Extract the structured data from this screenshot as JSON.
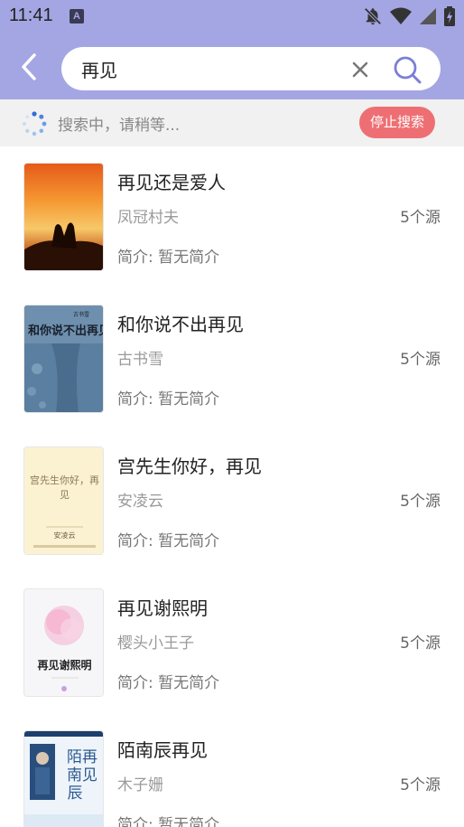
{
  "status_bar": {
    "time": "11:41",
    "notification_badge": "A",
    "icons": [
      "notifications-off-icon",
      "wifi-icon",
      "signal-icon",
      "battery-charging-icon"
    ]
  },
  "search": {
    "back_icon": "back-arrow-icon",
    "query": "再见",
    "clear_icon": "close-icon",
    "search_icon": "search-icon"
  },
  "progress": {
    "status_text": "搜索中，请稍等...",
    "stop_label": "停止搜索"
  },
  "books": [
    {
      "title": "再见还是爱人",
      "author": "凤冠村夫",
      "sources": "5个源",
      "intro": "简介: 暂无简介"
    },
    {
      "title": "和你说不出再见",
      "author": "古书雪",
      "sources": "5个源",
      "intro": "简介: 暂无简介"
    },
    {
      "title": "宫先生你好，再见",
      "author": "安凌云",
      "sources": "5个源",
      "intro": "简介: 暂无简介"
    },
    {
      "title": "再见谢熙明",
      "author": "樱头小王子",
      "sources": "5个源",
      "intro": "简介: 暂无简介"
    },
    {
      "title": "陌南辰再见",
      "author": "木子姗",
      "sources": "5个源",
      "intro": "简介: 暂无简介"
    }
  ],
  "covers": {
    "c2": {
      "title": "和你说不出再见",
      "author": "古书雪"
    },
    "c3": {
      "title_line1": "宫先生你好，再",
      "title_line2": "见",
      "author_label": "安凌云"
    },
    "c4": {
      "title": "再见谢熙明"
    },
    "c5": {
      "title_a": "陌再",
      "title_b": "南见",
      "title_c": "辰"
    }
  },
  "colors": {
    "header": "#a4a6e3",
    "accent": "#7b7fd6",
    "stop_button": "#ee6f73"
  }
}
